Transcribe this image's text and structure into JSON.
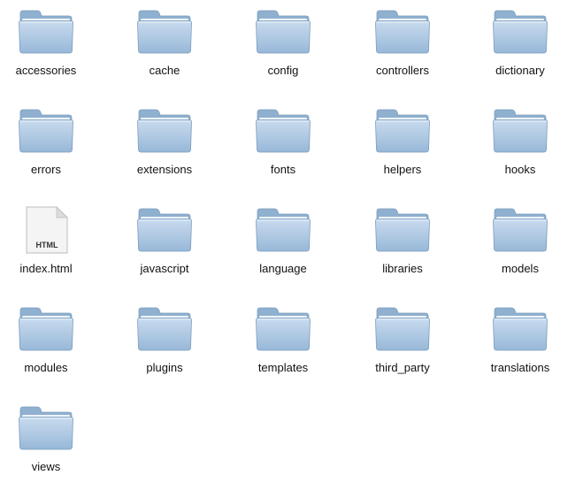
{
  "window": {
    "view": "icon-view"
  },
  "colors": {
    "folder_back": "#8fb0cf",
    "folder_front_top": "#c9dbee",
    "folder_front_bottom": "#97b8d8",
    "folder_edge": "#7c9dbd",
    "doc_fill": "#f4f4f4",
    "doc_edge": "#bdbdbd",
    "label_text": "#111111"
  },
  "items": [
    {
      "label": "accessories",
      "type": "folder",
      "icon": "folder-icon"
    },
    {
      "label": "cache",
      "type": "folder",
      "icon": "folder-icon"
    },
    {
      "label": "config",
      "type": "folder",
      "icon": "folder-icon"
    },
    {
      "label": "controllers",
      "type": "folder",
      "icon": "folder-icon"
    },
    {
      "label": "dictionary",
      "type": "folder",
      "icon": "folder-icon"
    },
    {
      "label": "errors",
      "type": "folder",
      "icon": "folder-icon"
    },
    {
      "label": "extensions",
      "type": "folder",
      "icon": "folder-icon"
    },
    {
      "label": "fonts",
      "type": "folder",
      "icon": "folder-icon"
    },
    {
      "label": "helpers",
      "type": "folder",
      "icon": "folder-icon"
    },
    {
      "label": "hooks",
      "type": "folder",
      "icon": "folder-icon"
    },
    {
      "label": "index.html",
      "type": "file",
      "icon": "html-document-icon",
      "badge": "HTML"
    },
    {
      "label": "javascript",
      "type": "folder",
      "icon": "folder-icon"
    },
    {
      "label": "language",
      "type": "folder",
      "icon": "folder-icon"
    },
    {
      "label": "libraries",
      "type": "folder",
      "icon": "folder-icon"
    },
    {
      "label": "models",
      "type": "folder",
      "icon": "folder-icon"
    },
    {
      "label": "modules",
      "type": "folder",
      "icon": "folder-icon"
    },
    {
      "label": "plugins",
      "type": "folder",
      "icon": "folder-icon"
    },
    {
      "label": "templates",
      "type": "folder",
      "icon": "folder-icon"
    },
    {
      "label": "third_party",
      "type": "folder",
      "icon": "folder-icon"
    },
    {
      "label": "translations",
      "type": "folder",
      "icon": "folder-icon"
    },
    {
      "label": "views",
      "type": "folder",
      "icon": "folder-icon"
    }
  ]
}
